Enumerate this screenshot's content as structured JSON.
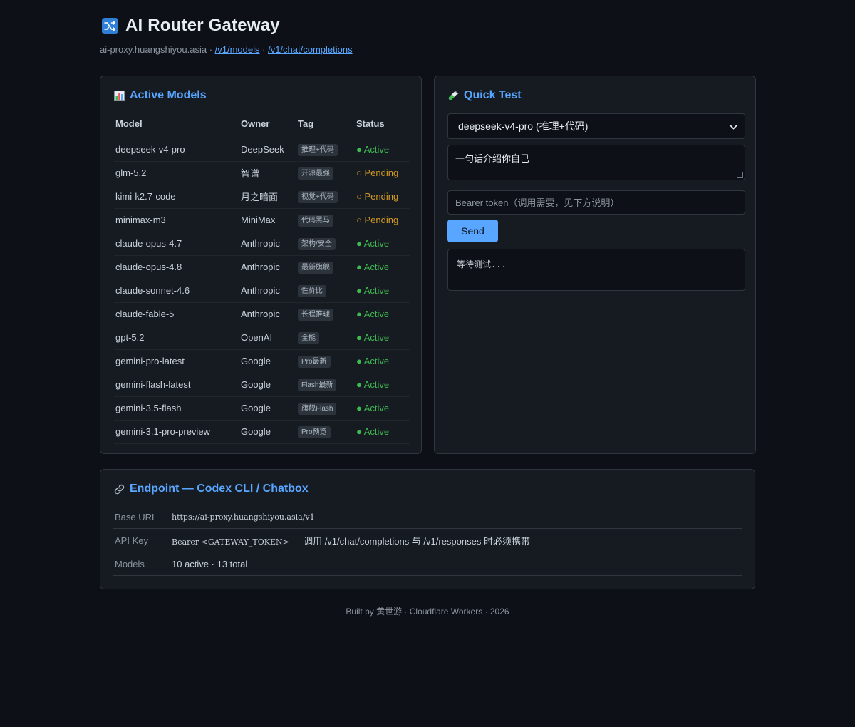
{
  "header": {
    "title": "AI Router Gateway",
    "host": "ai-proxy.huangshiyou.asia",
    "sep1": " · ",
    "link_models": "/v1/models",
    "sep2": " · ",
    "link_chat": "/v1/chat/completions"
  },
  "models_card": {
    "title": "Active Models",
    "columns": [
      "Model",
      "Owner",
      "Tag",
      "Status"
    ],
    "rows": [
      {
        "model": "deepseek-v4-pro",
        "owner": "DeepSeek",
        "tag": "推理+代码",
        "status": "● Active",
        "state": "active"
      },
      {
        "model": "glm-5.2",
        "owner": "智谱",
        "tag": "开源最强",
        "status": "○ Pending",
        "state": "pending"
      },
      {
        "model": "kimi-k2.7-code",
        "owner": "月之暗面",
        "tag": "视觉+代码",
        "status": "○ Pending",
        "state": "pending"
      },
      {
        "model": "minimax-m3",
        "owner": "MiniMax",
        "tag": "代码黑马",
        "status": "○ Pending",
        "state": "pending"
      },
      {
        "model": "claude-opus-4.7",
        "owner": "Anthropic",
        "tag": "架构/安全",
        "status": "● Active",
        "state": "active"
      },
      {
        "model": "claude-opus-4.8",
        "owner": "Anthropic",
        "tag": "最新旗舰",
        "status": "● Active",
        "state": "active"
      },
      {
        "model": "claude-sonnet-4.6",
        "owner": "Anthropic",
        "tag": "性价比",
        "status": "● Active",
        "state": "active"
      },
      {
        "model": "claude-fable-5",
        "owner": "Anthropic",
        "tag": "长程推理",
        "status": "● Active",
        "state": "active"
      },
      {
        "model": "gpt-5.2",
        "owner": "OpenAI",
        "tag": "全能",
        "status": "● Active",
        "state": "active"
      },
      {
        "model": "gemini-pro-latest",
        "owner": "Google",
        "tag": "Pro最新",
        "status": "● Active",
        "state": "active"
      },
      {
        "model": "gemini-flash-latest",
        "owner": "Google",
        "tag": "Flash最新",
        "status": "● Active",
        "state": "active"
      },
      {
        "model": "gemini-3.5-flash",
        "owner": "Google",
        "tag": "旗舰Flash",
        "status": "● Active",
        "state": "active"
      },
      {
        "model": "gemini-3.1-pro-preview",
        "owner": "Google",
        "tag": "Pro预览",
        "status": "● Active",
        "state": "active"
      }
    ]
  },
  "quick_test": {
    "title": "Quick Test",
    "selected_model": "deepseek-v4-pro (推理+代码)",
    "prompt_value": "一句话介绍你自己",
    "token_placeholder": "Bearer token（调用需要，见下方说明）",
    "send_label": "Send",
    "output_text": "等待测试..."
  },
  "endpoint": {
    "title": "Endpoint — Codex CLI / Chatbox",
    "base_url_label": "Base URL",
    "base_url_value": "https://ai-proxy.huangshiyou.asia/v1",
    "api_key_label": "API Key",
    "api_key_code": "Bearer <GATEWAY_TOKEN>",
    "api_key_note": " — 调用 /v1/chat/completions 与 /v1/responses 时必须携带",
    "models_label": "Models",
    "models_value": "10 active · 13 total"
  },
  "footer": {
    "text": "Built by 黄世游 · Cloudflare Workers · 2026"
  },
  "colors": {
    "background": "#0d1117",
    "card": "#161b22",
    "accent": "#58a6ff",
    "active": "#3fb950",
    "pending": "#d29922"
  },
  "icons": {
    "logo": "shuffle-icon",
    "models": "bar-chart-icon",
    "test": "test-tube-icon",
    "endpoint": "link-icon"
  }
}
